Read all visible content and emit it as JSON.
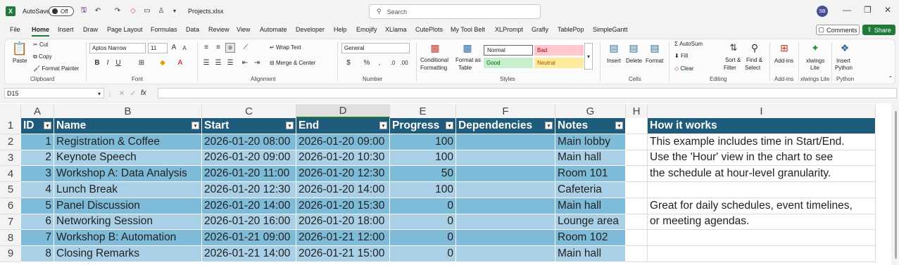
{
  "titlebar": {
    "autosave_label": "AutoSave",
    "autosave_state": "Off",
    "filename": "Projects.xlsx",
    "search_placeholder": "Search",
    "user_initials": "SB"
  },
  "menu": [
    "File",
    "Home",
    "Insert",
    "Draw",
    "Page Layout",
    "Formulas",
    "Data",
    "Review",
    "View",
    "Automate",
    "Developer",
    "Help",
    "Emojify",
    "XLlama",
    "CutePlots",
    "My Tool Belt",
    "XLPrompt",
    "Grafly",
    "TablePop",
    "SimpleGantt"
  ],
  "menu_active": "Home",
  "header_buttons": {
    "comments": "Comments",
    "share": "Share"
  },
  "ribbon": {
    "clipboard": {
      "paste": "Paste",
      "cut": "Cut",
      "copy": "Copy",
      "format_painter": "Format Painter",
      "label": "Clipboard"
    },
    "font": {
      "name": "Aptos Narrow",
      "size": "11",
      "label": "Font"
    },
    "alignment": {
      "wrap_text": "Wrap Text",
      "merge_center": "Merge & Center",
      "label": "Alignment"
    },
    "number": {
      "format": "General",
      "label": "Number"
    },
    "styles": {
      "conditional": [
        "Conditional",
        "Formatting"
      ],
      "format_table": [
        "Format as",
        "Table"
      ],
      "normal": "Normal",
      "bad": "Bad",
      "good": "Good",
      "neutral": "Neutral",
      "label": "Styles"
    },
    "cells": {
      "insert": "Insert",
      "delete": "Delete",
      "format": "Format",
      "label": "Cells"
    },
    "editing": {
      "autosum": "AutoSum",
      "fill": "Fill",
      "clear": "Clear",
      "sort_filter": [
        "Sort &",
        "Filter"
      ],
      "find_select": [
        "Find &",
        "Select"
      ],
      "label": "Editing"
    },
    "addins": {
      "addins": "Add-ins",
      "label": "Add-ins"
    },
    "xlwings": {
      "name": [
        "xlwings",
        "Lite"
      ],
      "label": "xlwings Lite"
    },
    "python": {
      "insert": [
        "Insert",
        "Python"
      ],
      "label": "Python"
    }
  },
  "formula_bar": {
    "name_box": "D15",
    "fx": "fx"
  },
  "columns": [
    "A",
    "B",
    "C",
    "D",
    "E",
    "F",
    "G",
    "H",
    "I"
  ],
  "selected_column": "D",
  "rows": [
    "1",
    "2",
    "3",
    "4",
    "5",
    "6",
    "7",
    "8",
    "9"
  ],
  "table": {
    "headers": [
      "ID",
      "Name",
      "Start",
      "End",
      "Progress",
      "Dependencies",
      "Notes"
    ],
    "data": [
      [
        "1",
        "Registration & Coffee",
        "2026-01-20 08:00",
        "2026-01-20 09:00",
        "100",
        "",
        "Main lobby"
      ],
      [
        "2",
        "Keynote Speech",
        "2026-01-20 09:00",
        "2026-01-20 10:30",
        "100",
        "",
        "Main hall"
      ],
      [
        "3",
        "Workshop A: Data Analysis",
        "2026-01-20 11:00",
        "2026-01-20 12:30",
        "50",
        "",
        "Room 101"
      ],
      [
        "4",
        "Lunch Break",
        "2026-01-20 12:30",
        "2026-01-20 14:00",
        "100",
        "",
        "Cafeteria"
      ],
      [
        "5",
        "Panel Discussion",
        "2026-01-20 14:00",
        "2026-01-20 15:30",
        "0",
        "",
        "Main hall"
      ],
      [
        "6",
        "Networking Session",
        "2026-01-20 16:00",
        "2026-01-20 18:00",
        "0",
        "",
        "Lounge area"
      ],
      [
        "7",
        "Workshop B: Automation",
        "2026-01-21 09:00",
        "2026-01-21 12:00",
        "0",
        "",
        "Room 102"
      ],
      [
        "8",
        "Closing Remarks",
        "2026-01-21 14:00",
        "2026-01-21 15:00",
        "0",
        "",
        "Main hall"
      ]
    ]
  },
  "how_it_works": {
    "header": "How it works",
    "lines": [
      "This example includes time in Start/End.",
      "Use the 'Hour' view in the chart to see",
      "the schedule at hour-level granularity.",
      "",
      "Great for daily schedules, event timelines,",
      "or meeting agendas.",
      "",
      ""
    ]
  },
  "colors": {
    "header": "#1f5b7a",
    "band_dark": "#7ebbd8",
    "band_light": "#a9d0e6",
    "accent": "#1f7a3a"
  }
}
